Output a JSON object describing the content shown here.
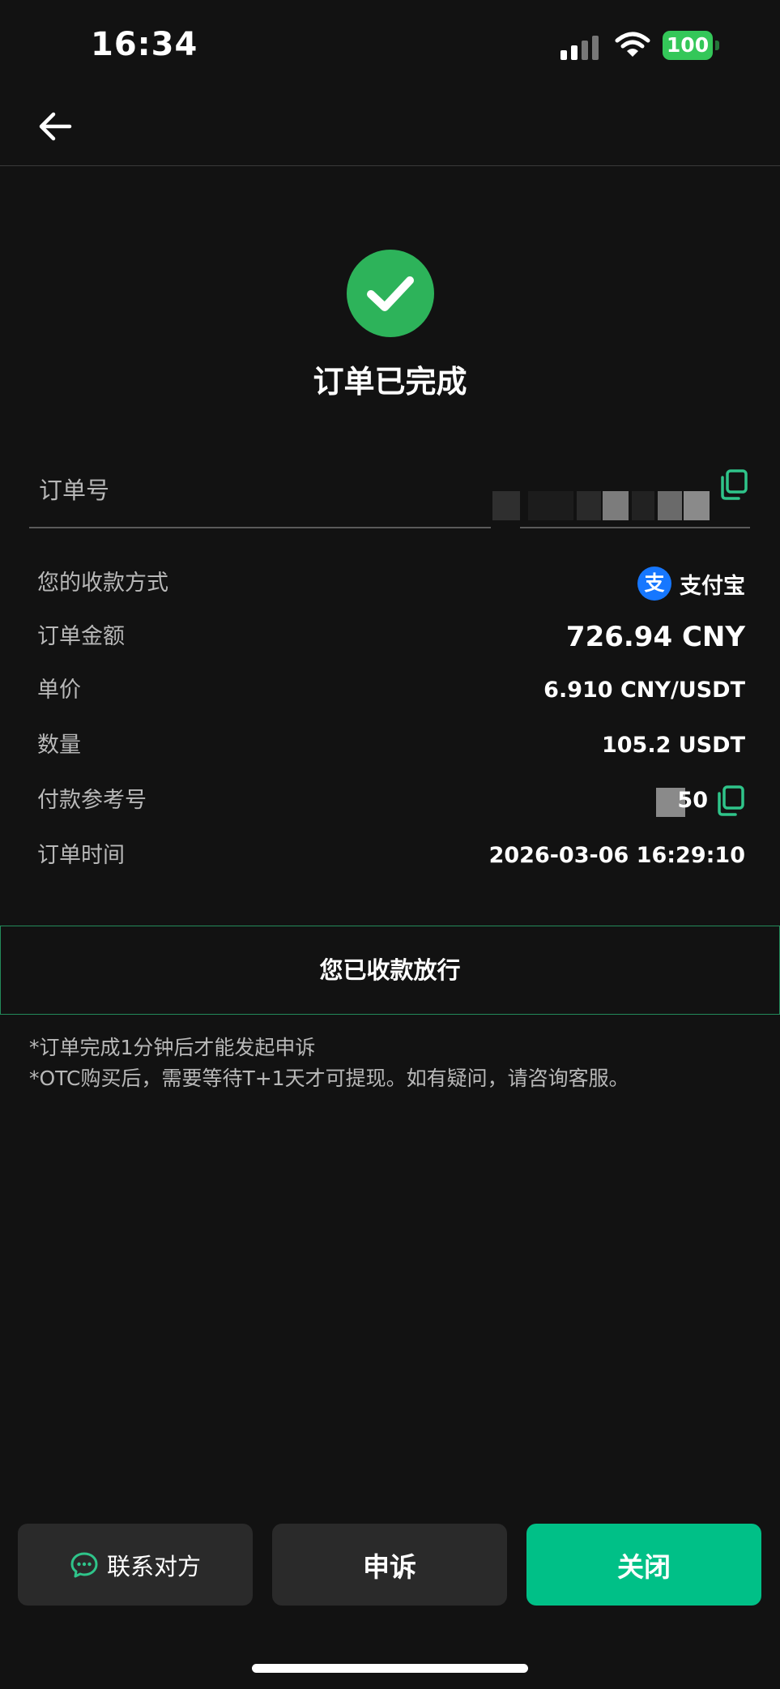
{
  "status_bar": {
    "time": "16:34",
    "battery": "100"
  },
  "page": {
    "title": "订单已完成"
  },
  "order_number": {
    "label": "订单号",
    "value_masked": ""
  },
  "details": [
    {
      "label": "您的收款方式",
      "value": "支付宝",
      "icon": "alipay-icon"
    },
    {
      "label": "订单金额",
      "value": "726.94 CNY"
    },
    {
      "label": "单价",
      "value": "6.910 CNY/USDT"
    },
    {
      "label": "数量",
      "value": "105.2 USDT"
    },
    {
      "label": "付款参考号",
      "value": "50"
    },
    {
      "label": "订单时间",
      "value": "2026-03-06 16:29:10"
    }
  ],
  "release_status": "您已收款放行",
  "notes": [
    "*订单完成1分钟后才能发起申诉",
    "*OTC购买后，需要等待T+1天才可提现。如有疑问，请咨询客服。"
  ],
  "footer": {
    "contact_label": "联系对方",
    "appeal_label": "申诉",
    "close_label": "关闭"
  },
  "colors": {
    "accent": "#00c087",
    "success": "#2db35a",
    "background": "#121212",
    "alipay": "#1677ff"
  },
  "icons": [
    "back-arrow-icon",
    "check-circle-icon",
    "copy-icon",
    "alipay-icon",
    "chat-icon",
    "signal-icon",
    "wifi-icon",
    "battery-icon"
  ]
}
